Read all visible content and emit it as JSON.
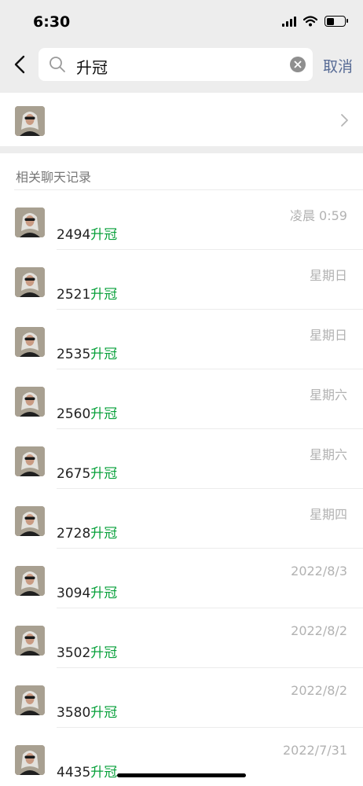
{
  "status_bar": {
    "time": "6:30"
  },
  "search": {
    "query": "升冠",
    "cancel_label": "取消"
  },
  "section": {
    "title": "相关聊天记录"
  },
  "results": [
    {
      "time": "凌晨 0:59",
      "number": "2494",
      "keyword": "升冠"
    },
    {
      "time": "星期日",
      "number": "2521",
      "keyword": "升冠"
    },
    {
      "time": "星期日",
      "number": "2535",
      "keyword": "升冠"
    },
    {
      "time": "星期六",
      "number": "2560",
      "keyword": "升冠"
    },
    {
      "time": "星期六",
      "number": "2675",
      "keyword": "升冠"
    },
    {
      "time": "星期四",
      "number": "2728",
      "keyword": "升冠"
    },
    {
      "time": "2022/8/3",
      "number": "3094",
      "keyword": "升冠"
    },
    {
      "time": "2022/8/2",
      "number": "3502",
      "keyword": "升冠"
    },
    {
      "time": "2022/8/2",
      "number": "3580",
      "keyword": "升冠"
    },
    {
      "time": "2022/7/31",
      "number": "4435",
      "keyword": "升冠"
    }
  ],
  "colors": {
    "highlight": "#07a03a",
    "link": "#576b95",
    "background": "#ededed"
  },
  "icons": [
    "signal-icon",
    "wifi-icon",
    "battery-icon",
    "back-icon",
    "search-icon",
    "clear-icon",
    "chevron-right-icon",
    "avatar"
  ]
}
